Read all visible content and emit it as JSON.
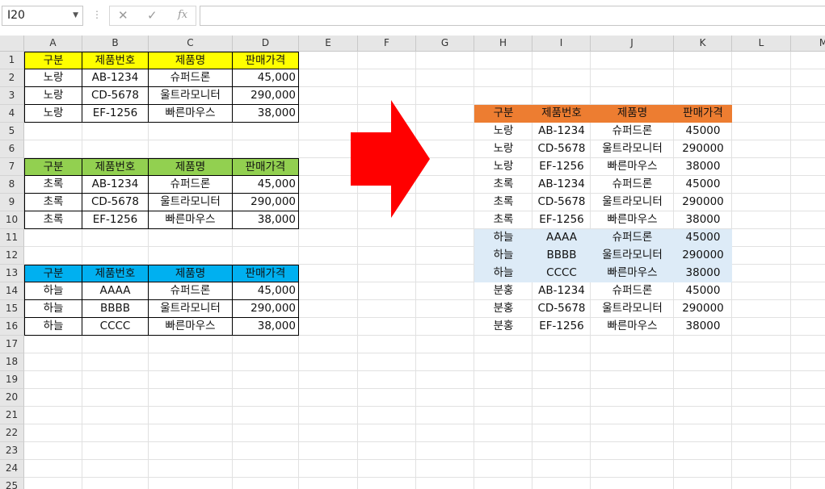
{
  "namebox": {
    "value": "I20"
  },
  "formula_bar": {
    "cancel_icon": "✕",
    "enter_icon": "✓",
    "fx_label": "fx",
    "value": ""
  },
  "columns": [
    "A",
    "B",
    "C",
    "D",
    "E",
    "F",
    "G",
    "H",
    "I",
    "J",
    "K",
    "L",
    "M"
  ],
  "rows": [
    "1",
    "2",
    "3",
    "4",
    "5",
    "6",
    "7",
    "8",
    "9",
    "10",
    "11",
    "12",
    "13",
    "14",
    "15",
    "16",
    "17",
    "18",
    "19",
    "20",
    "21",
    "22",
    "23",
    "24",
    "25"
  ],
  "colors": {
    "yellow": "#FFFF00",
    "green": "#92D050",
    "blue": "#00B0F0",
    "orange": "#ED7D31",
    "lightblue": "#DDEBF7",
    "arrow": "#FF0000"
  },
  "tables": [
    {
      "headers": [
        "구분",
        "제품번호",
        "제품명",
        "판매가격"
      ],
      "rows": [
        [
          "노랑",
          "AB-1234",
          "슈퍼드론",
          "45,000"
        ],
        [
          "노랑",
          "CD-5678",
          "울트라모니터",
          "290,000"
        ],
        [
          "노랑",
          "EF-1256",
          "빠른마우스",
          "38,000"
        ]
      ]
    },
    {
      "headers": [
        "구분",
        "제품번호",
        "제품명",
        "판매가격"
      ],
      "rows": [
        [
          "초록",
          "AB-1234",
          "슈퍼드론",
          "45,000"
        ],
        [
          "초록",
          "CD-5678",
          "울트라모니터",
          "290,000"
        ],
        [
          "초록",
          "EF-1256",
          "빠른마우스",
          "38,000"
        ]
      ]
    },
    {
      "headers": [
        "구분",
        "제품번호",
        "제품명",
        "판매가격"
      ],
      "rows": [
        [
          "하늘",
          "AAAA",
          "슈퍼드론",
          "45,000"
        ],
        [
          "하늘",
          "BBBB",
          "울트라모니터",
          "290,000"
        ],
        [
          "하늘",
          "CCCC",
          "빠른마우스",
          "38,000"
        ]
      ]
    }
  ],
  "result": {
    "headers": [
      "구분",
      "제품번호",
      "제품명",
      "판매가격"
    ],
    "rows": [
      [
        "노랑",
        "AB-1234",
        "슈퍼드론",
        "45000"
      ],
      [
        "노랑",
        "CD-5678",
        "울트라모니터",
        "290000"
      ],
      [
        "노랑",
        "EF-1256",
        "빠른마우스",
        "38000"
      ],
      [
        "초록",
        "AB-1234",
        "슈퍼드론",
        "45000"
      ],
      [
        "초록",
        "CD-5678",
        "울트라모니터",
        "290000"
      ],
      [
        "초록",
        "EF-1256",
        "빠른마우스",
        "38000"
      ],
      [
        "하늘",
        "AAAA",
        "슈퍼드론",
        "45000"
      ],
      [
        "하늘",
        "BBBB",
        "울트라모니터",
        "290000"
      ],
      [
        "하늘",
        "CCCC",
        "빠른마우스",
        "38000"
      ],
      [
        "분홍",
        "AB-1234",
        "슈퍼드론",
        "45000"
      ],
      [
        "분홍",
        "CD-5678",
        "울트라모니터",
        "290000"
      ],
      [
        "분홍",
        "EF-1256",
        "빠른마우스",
        "38000"
      ]
    ]
  },
  "arrow_icon": "right-arrow-icon"
}
